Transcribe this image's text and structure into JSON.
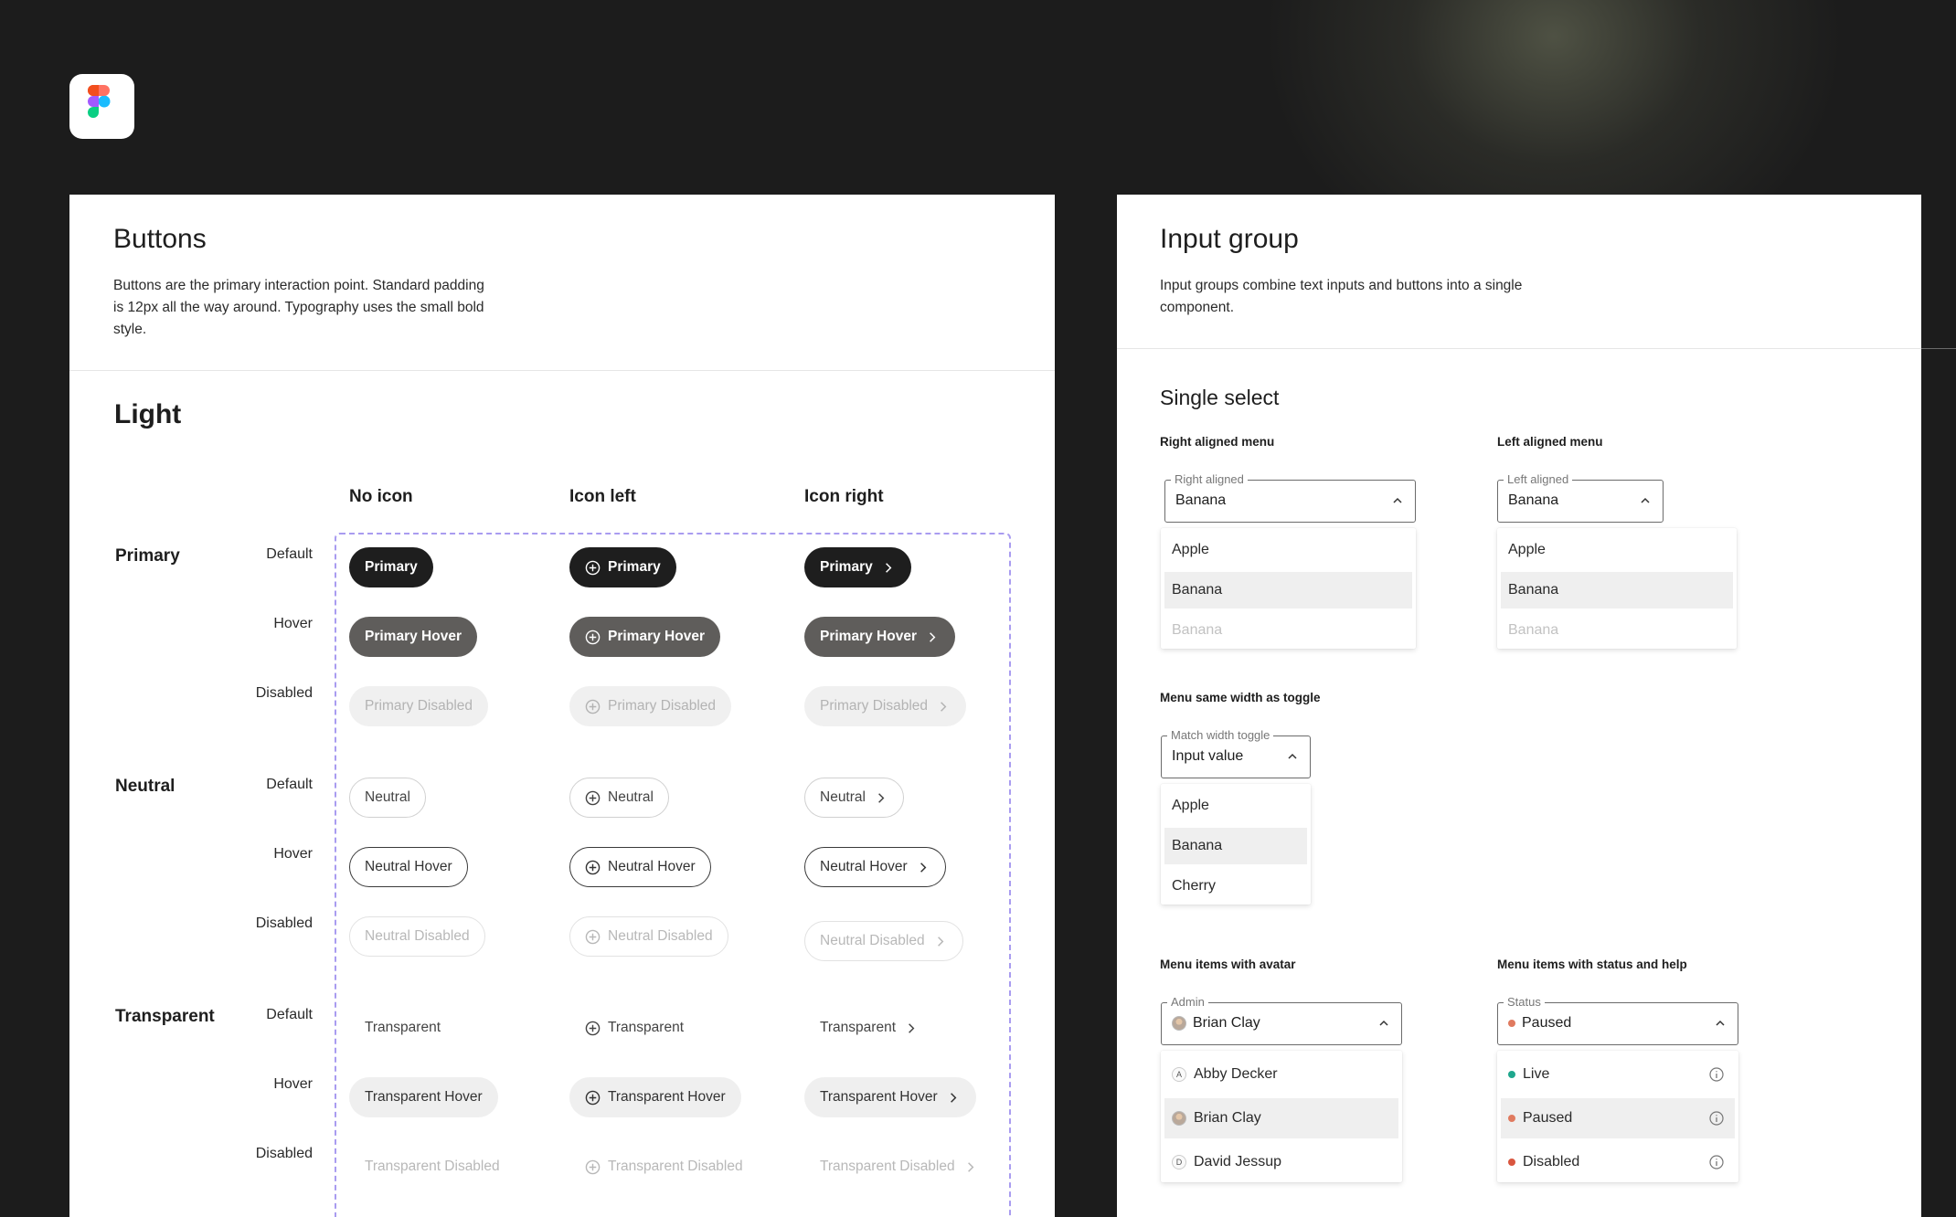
{
  "colors": {
    "background": "#1c1c1c",
    "primary": "#1e1e1e",
    "primary_hover": "#5f5d5b",
    "disabled_fill": "#f0f0f0",
    "dashed_border": "#a99cf0",
    "status_live": "#1fa78d",
    "status_paused": "#e07a5f",
    "status_disabled": "#d9563f"
  },
  "app_icon": "figma-logo",
  "buttons": {
    "title": "Buttons",
    "description": "Buttons are the primary interaction point. Standard padding is 12px all the way around. Typography uses the small bold style.",
    "theme": "Light",
    "columns": [
      "No icon",
      "Icon left",
      "Icon right"
    ],
    "groups": [
      {
        "name": "Primary",
        "states": [
          "Default",
          "Hover",
          "Disabled"
        ],
        "labels": [
          "Primary",
          "Primary Hover",
          "Primary Disabled"
        ]
      },
      {
        "name": "Neutral",
        "states": [
          "Default",
          "Hover",
          "Disabled"
        ],
        "labels": [
          "Neutral",
          "Neutral Hover",
          "Neutral Disabled"
        ]
      },
      {
        "name": "Transparent",
        "states": [
          "Default",
          "Hover",
          "Disabled"
        ],
        "labels": [
          "Transparent",
          "Transparent Hover",
          "Transparent Disabled"
        ]
      }
    ],
    "icon_left": "plus-circle-icon",
    "icon_right": "chevron-right-icon"
  },
  "input_group": {
    "title": "Input group",
    "description": "Input groups combine text inputs and buttons into a single component.",
    "section": "Single select",
    "right_aligned": {
      "label": "Right aligned menu",
      "legend": "Right aligned",
      "value": "Banana",
      "options": [
        "Apple",
        "Banana",
        "Banana"
      ]
    },
    "left_aligned": {
      "label": "Left aligned menu",
      "legend": "Left aligned",
      "value": "Banana",
      "options": [
        "Apple",
        "Banana",
        "Banana"
      ]
    },
    "match_width": {
      "label": "Menu same width as toggle",
      "legend": "Match width toggle",
      "value": "Input value",
      "options": [
        "Apple",
        "Banana",
        "Cherry"
      ]
    },
    "avatar_menu": {
      "label": "Menu items with avatar",
      "legend": "Admin",
      "value": "Brian Clay",
      "options": [
        {
          "name": "Abby Decker",
          "initial": "A"
        },
        {
          "name": "Brian Clay",
          "initial": ""
        },
        {
          "name": "David Jessup",
          "initial": "D"
        }
      ]
    },
    "status_menu": {
      "label": "Menu items with status and help",
      "legend": "Status",
      "value": "Paused",
      "options": [
        "Live",
        "Paused",
        "Disabled"
      ]
    }
  }
}
